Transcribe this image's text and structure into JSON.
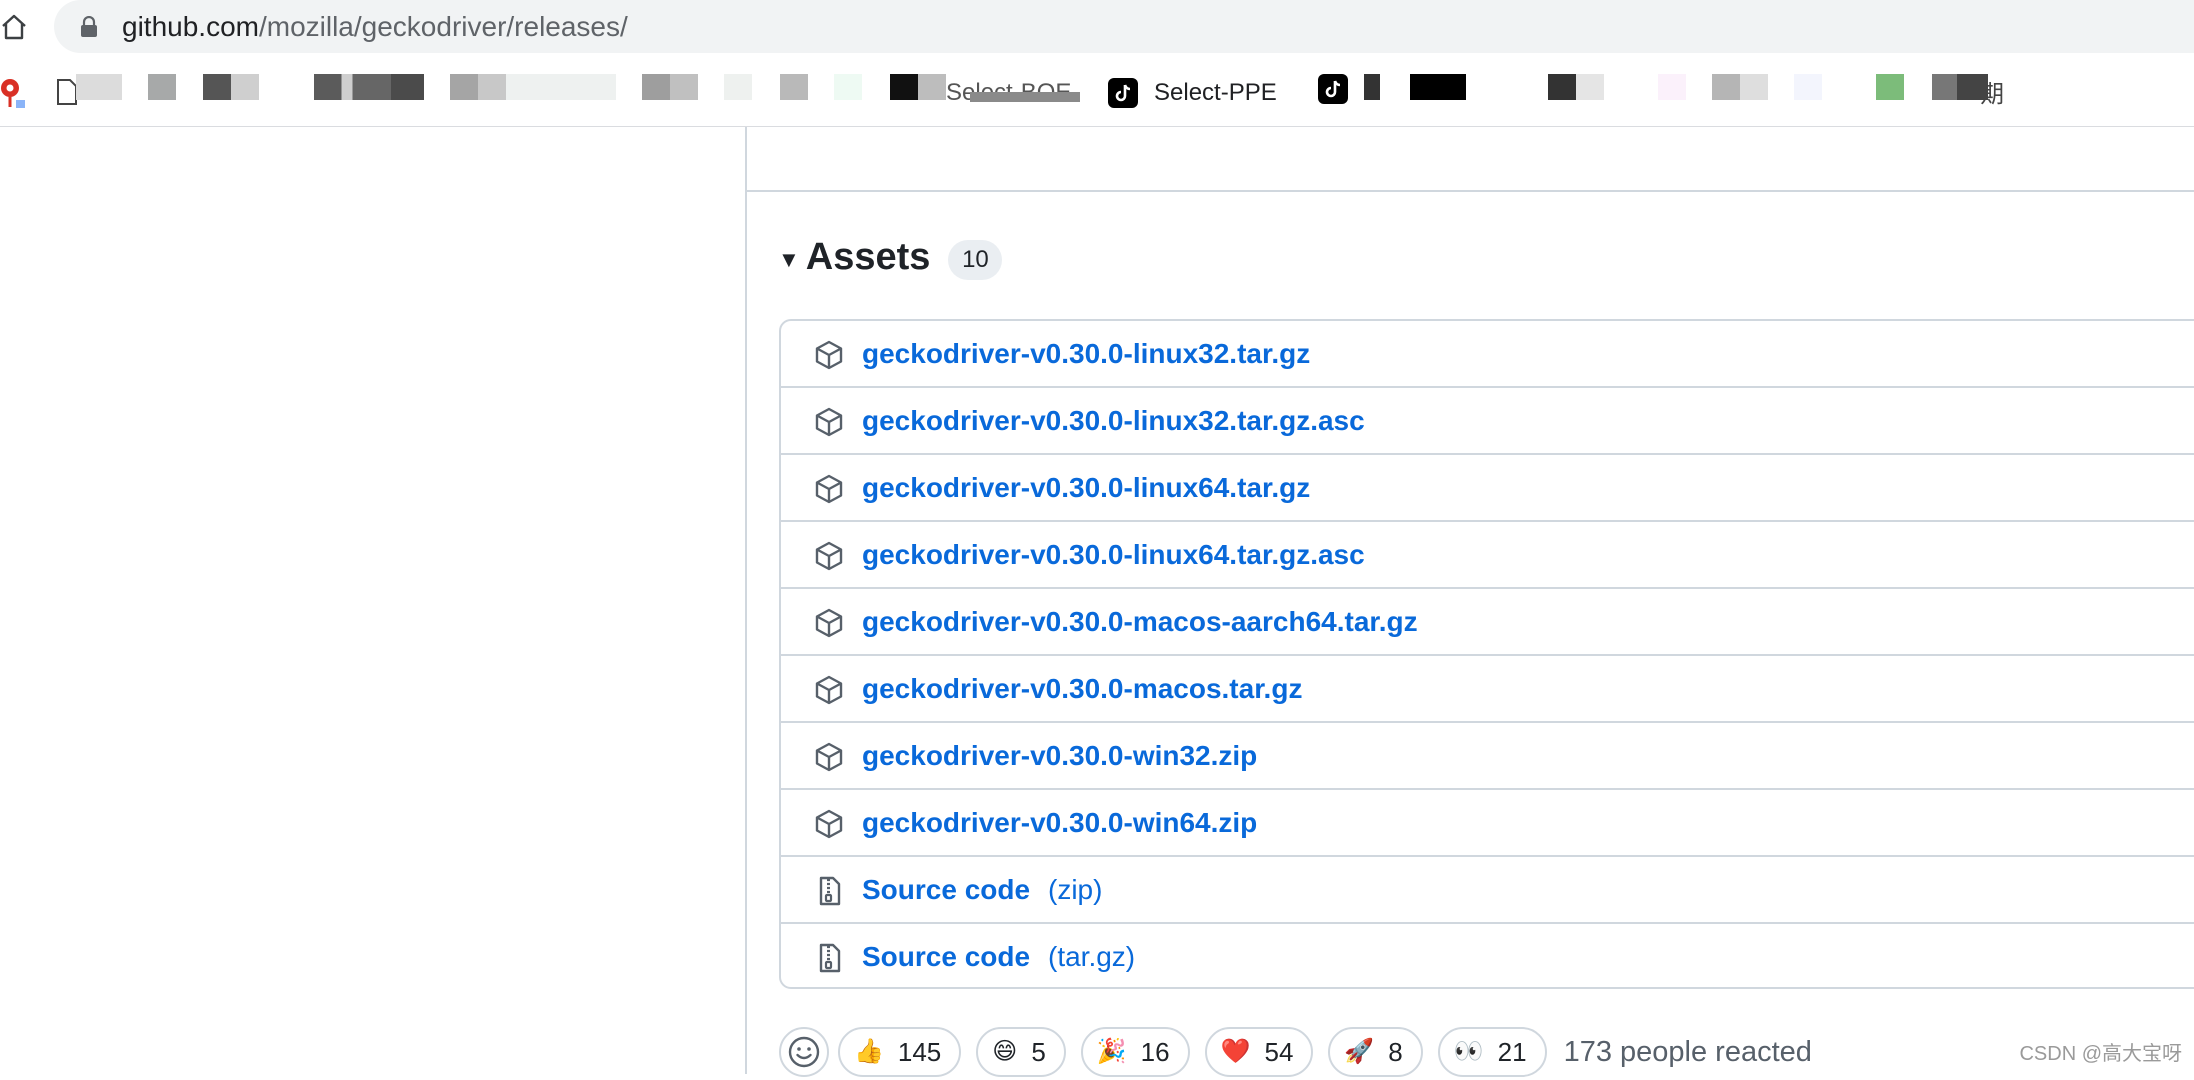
{
  "browser": {
    "url_host": "github.com",
    "url_path": "/mozilla/geckodriver/releases/"
  },
  "bookmarks": [
    {
      "label": "Select-BOE"
    },
    {
      "label": "Select-PPE"
    },
    {
      "label": "期"
    }
  ],
  "assets": {
    "title": "Assets",
    "count": "10",
    "items": [
      {
        "name": "geckodriver-v0.30.0-linux32.tar.gz",
        "ext": "",
        "kind": "package-icon"
      },
      {
        "name": "geckodriver-v0.30.0-linux32.tar.gz.asc",
        "ext": "",
        "kind": "package-icon"
      },
      {
        "name": "geckodriver-v0.30.0-linux64.tar.gz",
        "ext": "",
        "kind": "package-icon"
      },
      {
        "name": "geckodriver-v0.30.0-linux64.tar.gz.asc",
        "ext": "",
        "kind": "package-icon"
      },
      {
        "name": "geckodriver-v0.30.0-macos-aarch64.tar.gz",
        "ext": "",
        "kind": "package-icon"
      },
      {
        "name": "geckodriver-v0.30.0-macos.tar.gz",
        "ext": "",
        "kind": "package-icon"
      },
      {
        "name": "geckodriver-v0.30.0-win32.zip",
        "ext": "",
        "kind": "package-icon"
      },
      {
        "name": "geckodriver-v0.30.0-win64.zip",
        "ext": "",
        "kind": "package-icon"
      },
      {
        "name": "Source code",
        "ext": "(zip)",
        "kind": "file-zip-icon"
      },
      {
        "name": "Source code",
        "ext": "(tar.gz)",
        "kind": "file-zip-icon"
      }
    ]
  },
  "reactions": {
    "items": [
      {
        "emoji": "👍",
        "icon": "thumbs-up-icon",
        "count": "145"
      },
      {
        "emoji": "😄",
        "icon": "laugh-icon",
        "count": "5"
      },
      {
        "emoji": "🎉",
        "icon": "hooray-icon",
        "count": "16"
      },
      {
        "emoji": "❤️",
        "icon": "heart-icon",
        "count": "54"
      },
      {
        "emoji": "🚀",
        "icon": "rocket-icon",
        "count": "8"
      },
      {
        "emoji": "👀",
        "icon": "eyes-icon",
        "count": "21"
      }
    ],
    "summary": "173 people reacted"
  },
  "watermark": "CSDN @高大宝呀",
  "colors": {
    "link": "#0969da",
    "border": "#d0d7de",
    "counter_bg": "#eaeef2"
  }
}
